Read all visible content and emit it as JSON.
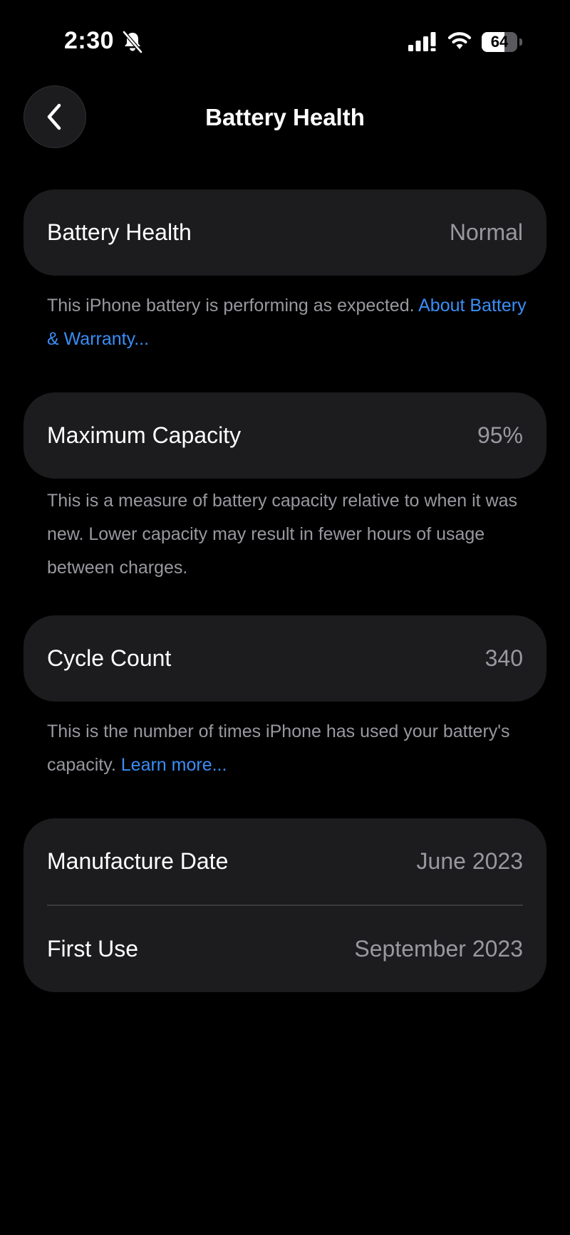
{
  "status_bar": {
    "time": "2:30",
    "battery_level": "64",
    "battery_fraction": 0.64
  },
  "nav": {
    "title": "Battery Health"
  },
  "battery_health": {
    "label": "Battery Health",
    "value": "Normal",
    "footnote_text": "This iPhone battery is performing as expected.",
    "footnote_link": "About Battery & Warranty..."
  },
  "maximum_capacity": {
    "label": "Maximum Capacity",
    "value": "95%",
    "footnote_text": "This is a measure of battery capacity relative to when it was new. Lower capacity may result in fewer hours of usage between charges."
  },
  "cycle_count": {
    "label": "Cycle Count",
    "value": "340",
    "footnote_text": "This is the number of times iPhone has used your battery's capacity.",
    "footnote_link": "Learn more..."
  },
  "dates": {
    "manufacture_label": "Manufacture Date",
    "manufacture_value": "June 2023",
    "first_use_label": "First Use",
    "first_use_value": "September 2023"
  },
  "colors": {
    "background": "#000000",
    "card": "#1c1c1e",
    "secondary_text": "#98989f",
    "link": "#3a8ef6"
  },
  "icons": {
    "back": "chevron-left-icon",
    "silent": "bell-slash-icon",
    "signal": "cellular-signal-icon",
    "wifi": "wifi-icon",
    "battery": "battery-icon"
  }
}
